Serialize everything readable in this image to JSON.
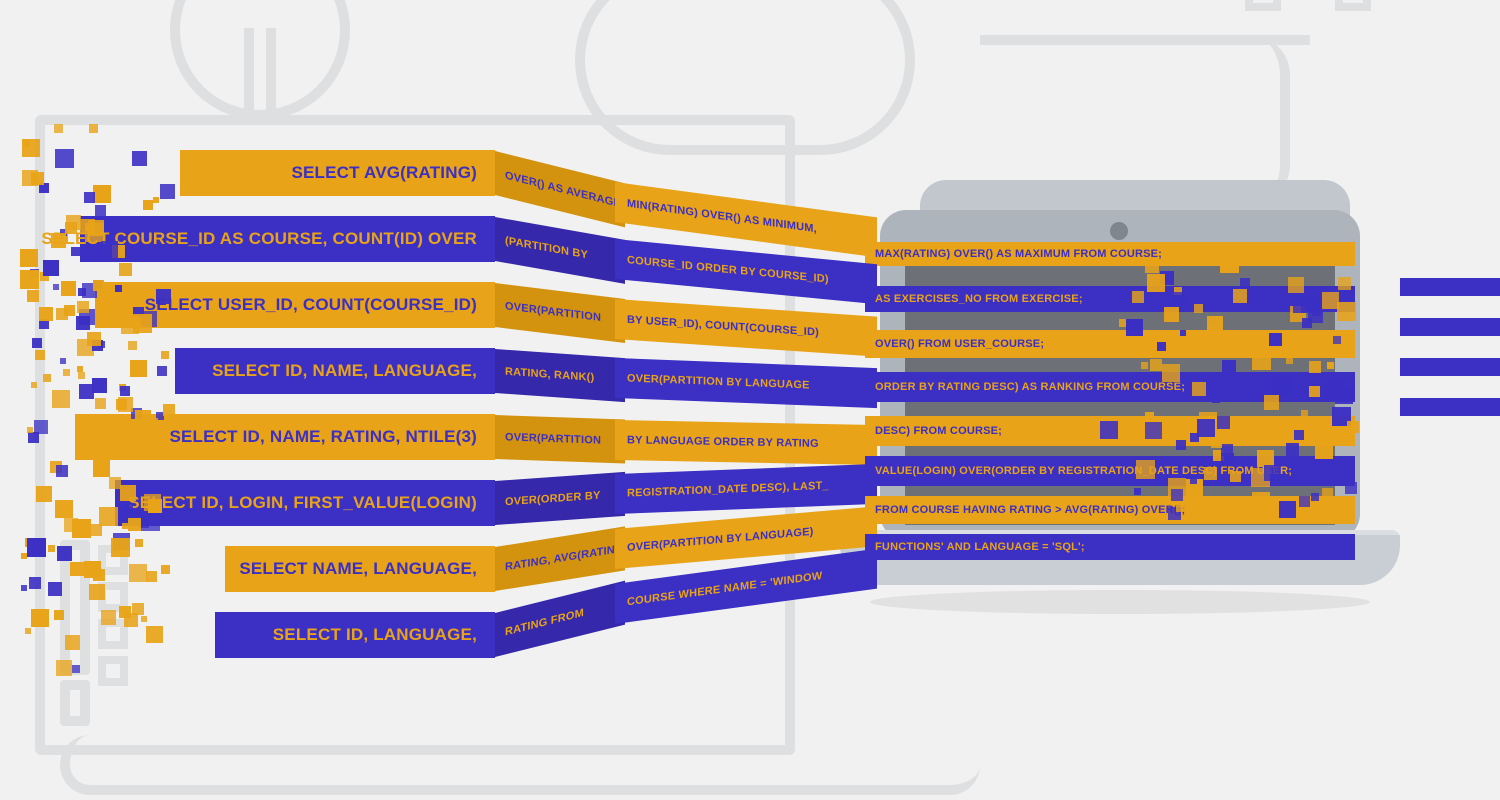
{
  "rows": [
    {
      "color": "gold",
      "a": "SELECT AVG(RATING)",
      "b": "OVER() AS AVERAGE,",
      "c": "MIN(RATING) OVER() AS MINIMUM,",
      "d": "MAX(RATING) OVER() AS MAXIMUM  FROM COURSE;"
    },
    {
      "color": "blue",
      "a": "SELECT COURSE_ID AS COURSE, COUNT(ID) OVER",
      "b": "(PARTITION BY",
      "c": "COURSE_ID ORDER BY COURSE_ID)",
      "d": "AS EXERCISES_NO FROM EXERCISE;"
    },
    {
      "color": "gold",
      "a": "SELECT USER_ID, COUNT(COURSE_ID)",
      "b": "OVER(PARTITION",
      "c": "BY USER_ID), COUNT(COURSE_ID)",
      "d": "OVER() FROM USER_COURSE;"
    },
    {
      "color": "blue",
      "a": "SELECT ID, NAME, LANGUAGE,",
      "b": "RATING, RANK()",
      "c": "OVER(PARTITION BY LANGUAGE",
      "d": "ORDER BY RATING DESC) AS RANKING FROM COURSE;"
    },
    {
      "color": "gold",
      "a": "SELECT ID, NAME, RATING, NTILE(3)",
      "b": "OVER(PARTITION",
      "c": "BY LANGUAGE ORDER BY RATING",
      "d": "DESC) FROM COURSE;"
    },
    {
      "color": "blue",
      "a": "SELECT ID, LOGIN, FIRST_VALUE(LOGIN)",
      "b": "OVER(ORDER BY",
      "c": "REGISTRATION_DATE DESC), LAST_",
      "d": "VALUE(LOGIN) OVER(ORDER BY REGISTRATION_DATE DESC) FROM USER;"
    },
    {
      "color": "gold",
      "a": "SELECT NAME, LANGUAGE,",
      "b": "RATING, AVG(RATING)",
      "c": "OVER(PARTITION BY LANGUAGE)",
      "d": "FROM COURSE HAVING RATING > AVG(RATING) OVER();"
    },
    {
      "color": "blue",
      "a": "SELECT ID, LANGUAGE,",
      "b": "RATING FROM",
      "c": "COURSE WHERE NAME = 'WINDOW",
      "d": "FUNCTIONS' AND LANGUAGE = 'SQL';"
    }
  ]
}
